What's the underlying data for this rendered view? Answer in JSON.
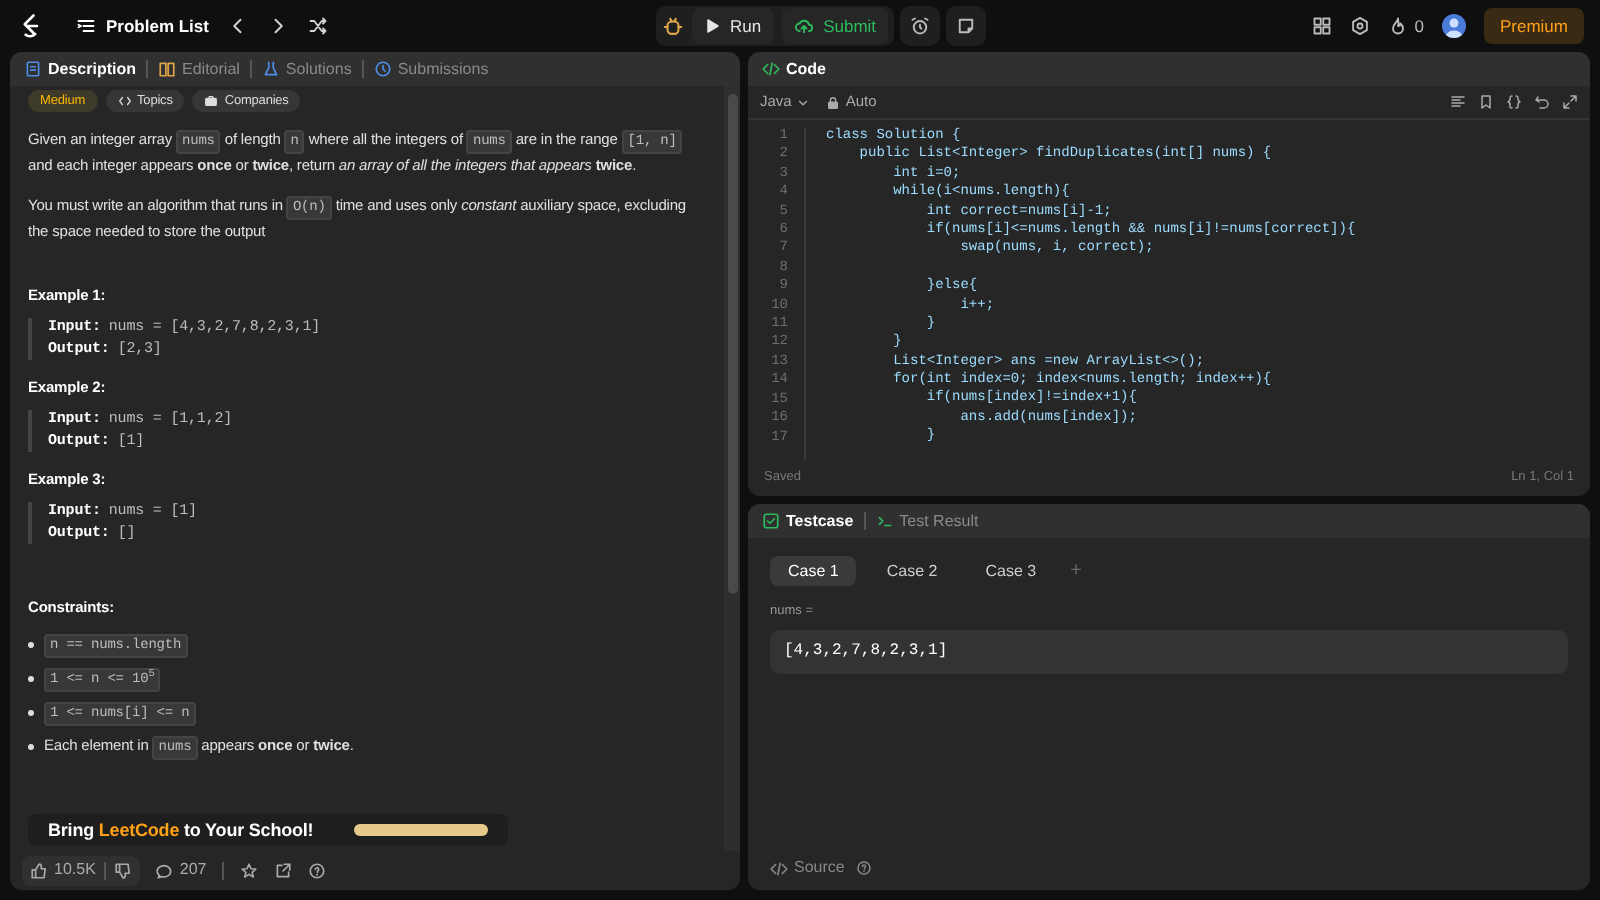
{
  "top_bar": {
    "problem_list": "Problem List",
    "run": "Run",
    "submit": "Submit",
    "streak": "0",
    "premium": "Premium"
  },
  "description_panel": {
    "tabs": [
      {
        "label": "Description",
        "selected": true
      },
      {
        "label": "Editorial",
        "selected": false
      },
      {
        "label": "Solutions",
        "selected": false
      },
      {
        "label": "Submissions",
        "selected": false
      }
    ],
    "difficulty": "Medium",
    "tags": [
      "Topics",
      "Companies"
    ],
    "paragraphs": [
      [
        {
          "kind": "text",
          "text": "Given an integer array "
        },
        {
          "kind": "code",
          "text": "nums"
        },
        {
          "kind": "text",
          "text": " of length "
        },
        {
          "kind": "code",
          "text": "n"
        },
        {
          "kind": "text",
          "text": " where all the integers of "
        },
        {
          "kind": "code",
          "text": "nums"
        },
        {
          "kind": "text",
          "text": " are in the range "
        },
        {
          "kind": "code",
          "text": "[1, n]"
        },
        {
          "kind": "text",
          "text": " and each integer appears **once** or **twice**, return *an array of all the integers that appears* **twice**."
        }
      ],
      [
        {
          "kind": "text",
          "text": "You must write an algorithm that runs in "
        },
        {
          "kind": "code",
          "text": "O(n)"
        },
        {
          "kind": "text",
          "text": " time and uses only *constant* auxiliary space, excluding the space needed to store the output"
        }
      ]
    ],
    "examples": [
      {
        "title": "Example 1:",
        "input_label": "Input:",
        "input": "nums = [4,3,2,7,8,2,3,1]",
        "output_label": "Output:",
        "output": "[2,3]"
      },
      {
        "title": "Example 2:",
        "input_label": "Input:",
        "input": "nums = [1,1,2]",
        "output_label": "Output:",
        "output": "[1]"
      },
      {
        "title": "Example 3:",
        "input_label": "Input:",
        "input": "nums = [1]",
        "output_label": "Output:",
        "output": "[]"
      }
    ],
    "constraints_title": "Constraints:",
    "constraints": [
      [
        {
          "kind": "code",
          "text": "n == nums.length"
        }
      ],
      [
        {
          "kind": "code",
          "text": "1 <= n <= 10$^{5}$"
        }
      ],
      [
        {
          "kind": "code",
          "text": "1 <= nums[i] <= n"
        }
      ],
      [
        {
          "kind": "text",
          "text": "Each element in "
        },
        {
          "kind": "code",
          "text": "nums"
        },
        {
          "kind": "text",
          "text": " appears **once** or **twice**."
        }
      ]
    ],
    "promo": [
      {
        "kind": "text",
        "text": "Bring "
      },
      {
        "kind": "brand",
        "text": "LeetCode"
      },
      {
        "kind": "text",
        "text": " to Your School!"
      }
    ],
    "footer": {
      "likes": "10.5K",
      "comments": "207"
    }
  },
  "code_panel": {
    "title": "Code",
    "language": "Java",
    "mode": "Auto",
    "lines": [
      {
        "number": "1",
        "text": "class Solution {"
      },
      {
        "number": "2",
        "text": "    public List<Integer> findDuplicates(int[] nums) {"
      },
      {
        "number": "3",
        "text": "        int i=0;"
      },
      {
        "number": "4",
        "text": "        while(i<nums.length){"
      },
      {
        "number": "5",
        "text": "            int correct=nums[i]-1;"
      },
      {
        "number": "6",
        "text": "            if(nums[i]<=nums.length && nums[i]!=nums[correct]){"
      },
      {
        "number": "7",
        "text": "                swap(nums, i, correct);"
      },
      {
        "number": "8"
      },
      {
        "number": "9",
        "text": "            }else{"
      },
      {
        "number": "10",
        "text": "                i++;"
      },
      {
        "number": "11",
        "text": "            }"
      },
      {
        "number": "12",
        "text": "        }"
      },
      {
        "number": "13",
        "text": "        List<Integer> ans =new ArrayList<>();"
      },
      {
        "number": "14",
        "text": "        for(int index=0; index<nums.length; index++){"
      },
      {
        "number": "15",
        "text": "            if(nums[index]!=index+1){"
      },
      {
        "number": "16",
        "text": "                ans.add(nums[index]);"
      },
      {
        "number": "17",
        "text": "            }"
      }
    ],
    "status": "Saved",
    "cursor": "Ln 1, Col 1"
  },
  "test_panel": {
    "tabs": [
      {
        "label": "Testcase",
        "selected": true
      },
      {
        "label": "Test Result",
        "selected": false
      }
    ],
    "cases": [
      {
        "label": "Case 1",
        "selected": true
      },
      {
        "label": "Case 2",
        "selected": false
      },
      {
        "label": "Case 3",
        "selected": false
      }
    ],
    "add": "+",
    "param_label": "nums =",
    "param_value": "[4,3,2,7,8,2,3,1]",
    "source": "Source"
  }
}
